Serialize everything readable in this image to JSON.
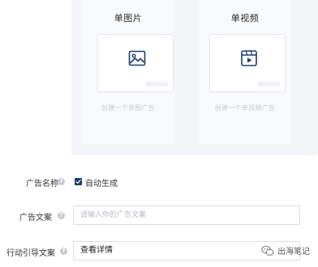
{
  "ad_formats": [
    {
      "title": "单图片",
      "description": "创建一个单图广告",
      "icon": "image-icon"
    },
    {
      "title": "单视频",
      "description": "创建一个单视频广告",
      "icon": "video-icon"
    }
  ],
  "form": {
    "ad_name": {
      "label": "广告名称",
      "checkbox_label": "自动生成",
      "checked": true
    },
    "ad_copy": {
      "label": "广告文案",
      "placeholder": "请输入你的广告文案"
    },
    "cta_copy": {
      "label": "行动引导文案",
      "value": "查看详情"
    }
  },
  "watermark": {
    "text": "出海笔记",
    "icon": "wechat-icon"
  },
  "colors": {
    "accent": "#1e3a6e",
    "panel_bg": "#f4f5f8",
    "muted_text": "#c8ccd4"
  }
}
